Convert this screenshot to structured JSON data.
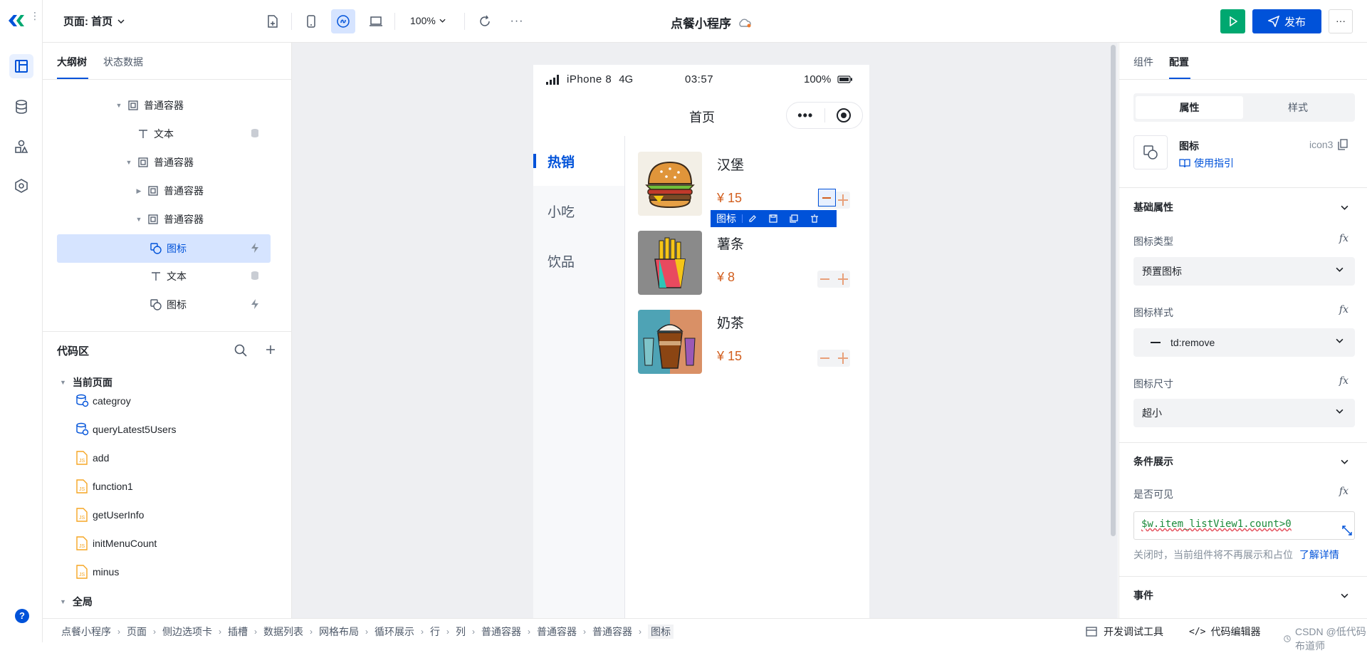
{
  "top": {
    "page_label": "页面: 首页",
    "zoom": "100%",
    "app_title": "点餐小程序",
    "publish_label": "发布"
  },
  "left": {
    "tabs": [
      "大纲树",
      "状态数据"
    ],
    "tree": [
      {
        "label": "普通容器",
        "icon": "container-icon",
        "toggle": "▼"
      },
      {
        "label": "文本",
        "icon": "text-icon",
        "right": "database-icon"
      },
      {
        "label": "普通容器",
        "icon": "container-icon",
        "toggle": "▼"
      },
      {
        "label": "普通容器",
        "icon": "container-icon",
        "toggle": "▶"
      },
      {
        "label": "普通容器",
        "icon": "container-icon",
        "toggle": "▼"
      },
      {
        "label": "图标",
        "icon": "icon-component-icon",
        "right": "lightning-icon",
        "selected": true
      },
      {
        "label": "文本",
        "icon": "text-icon",
        "right": "database-icon"
      },
      {
        "label": "图标",
        "icon": "icon-component-icon",
        "right": "lightning-icon"
      }
    ],
    "code_title": "代码区",
    "current_page": "当前页面",
    "code_items": [
      {
        "label": "categroy",
        "type": "query"
      },
      {
        "label": "queryLatest5Users",
        "type": "query"
      },
      {
        "label": "add",
        "type": "js"
      },
      {
        "label": "function1",
        "type": "js"
      },
      {
        "label": "getUserInfo",
        "type": "js"
      },
      {
        "label": "initMenuCount",
        "type": "js"
      },
      {
        "label": "minus",
        "type": "js"
      }
    ],
    "global": "全局"
  },
  "phone": {
    "device": "iPhone 8",
    "network": "4G",
    "time": "03:57",
    "battery": "100%",
    "nav_title": "首页",
    "menu": [
      {
        "label": "热销",
        "active": true
      },
      {
        "label": "小吃",
        "active": false
      },
      {
        "label": "饮品",
        "active": false
      }
    ],
    "foods": [
      {
        "name": "汉堡",
        "price": "¥ 15"
      },
      {
        "name": "薯条",
        "price": "¥ 8"
      },
      {
        "name": "奶茶",
        "price": "¥ 15"
      }
    ],
    "selection_label": "图标"
  },
  "right": {
    "tabs": [
      "组件",
      "配置"
    ],
    "seg": [
      "属性",
      "样式"
    ],
    "comp_name": "图标",
    "comp_id": "icon3",
    "guide": "使用指引",
    "basic_section": "基础属性",
    "icon_type_label": "图标类型",
    "icon_type_value": "预置图标",
    "icon_style_label": "图标样式",
    "icon_style_value": "td:remove",
    "icon_size_label": "图标尺寸",
    "icon_size_value": "超小",
    "cond_section": "条件展示",
    "visible_label": "是否可见",
    "visible_expr": "$w.item_listView1.count>0",
    "hint": "关闭时，当前组件将不再展示和占位",
    "hint_link": "了解详情",
    "event_section": "事件",
    "fx": "fx"
  },
  "bottom": {
    "breadcrumb": [
      "点餐小程序",
      "页面",
      "侧边选项卡",
      "插槽",
      "数据列表",
      "网格布局",
      "循环展示",
      "行",
      "列",
      "普通容器",
      "普通容器",
      "普通容器",
      "图标"
    ],
    "devtools": "开发调试工具",
    "code_editor": "代码编辑器",
    "watermark": "CSDN @低代码布道师"
  },
  "colors": {
    "primary": "#0052d9",
    "green": "#00a870",
    "price": "#d25f1f",
    "selected_bg": "#d6e4ff"
  }
}
